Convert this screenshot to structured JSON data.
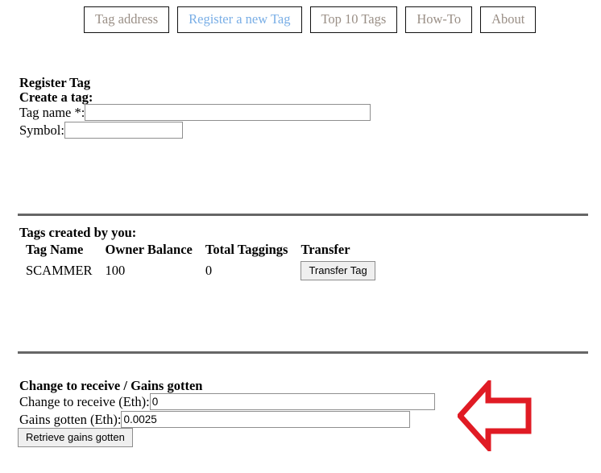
{
  "nav": {
    "items": [
      {
        "label": "Tag address",
        "active": false
      },
      {
        "label": "Register a new Tag",
        "active": true
      },
      {
        "label": "Top 10 Tags",
        "active": false
      },
      {
        "label": "How-To",
        "active": false
      },
      {
        "label": "About",
        "active": false
      }
    ],
    "active_color": "#79aee6",
    "inactive_color": "#9a8f86"
  },
  "register": {
    "title": "Register Tag",
    "subtitle": "Create a tag:",
    "tag_name_label": "Tag name *:",
    "tag_name_value": "",
    "tag_name_placeholder": "",
    "symbol_label": "Symbol:",
    "symbol_value": "",
    "symbol_placeholder": ""
  },
  "tags_table": {
    "heading": "Tags created by you:",
    "columns": [
      "Tag Name",
      "Owner Balance",
      "Total Taggings",
      "Transfer"
    ],
    "rows": [
      {
        "tag_name": "SCAMMER",
        "owner_balance": "100",
        "total_taggings": "0",
        "transfer_label": "Transfer Tag"
      }
    ]
  },
  "gains": {
    "heading": "Change to receive / Gains gotten",
    "change_label": "Change to receive (Eth):",
    "change_value": "0",
    "gains_label": "Gains gotten (Eth):",
    "gains_value": "0.0025",
    "retrieve_label": "Retrieve gains gotten"
  },
  "annotation": {
    "arrow_icon": "arrow-left-icon",
    "arrow_color": "#e01b24",
    "arrow_direction": "left"
  }
}
